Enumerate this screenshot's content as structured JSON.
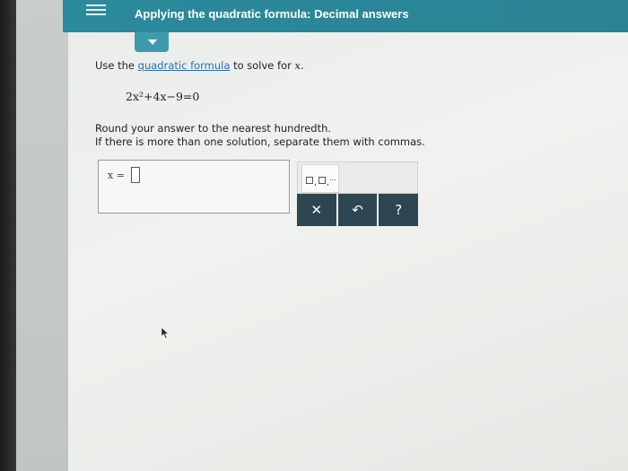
{
  "header": {
    "title": "Applying the quadratic formula: Decimal answers"
  },
  "question": {
    "intro_prefix": "Use the ",
    "link_text": "quadratic formula",
    "intro_suffix": " to solve for ",
    "variable": "x",
    "period": ".",
    "equation": "2x²+4x−9=0",
    "round_instruction": "Round your answer to the nearest hundredth.",
    "separate_instruction": "If there is more than one solution, separate them with commas."
  },
  "answer": {
    "label": "x =",
    "value": ""
  },
  "toolbar": {
    "template_comma": ",",
    "template_dots": "...",
    "clear_label": "✕",
    "undo_label": "↶",
    "help_label": "?"
  },
  "colors": {
    "header": "#2b8a9c",
    "toolbar_button": "#2e4552",
    "link": "#2a6fb0"
  },
  "icons": [
    "menu-icon",
    "chevron-down-icon",
    "undo-icon",
    "close-icon",
    "help-icon",
    "cursor-icon"
  ]
}
